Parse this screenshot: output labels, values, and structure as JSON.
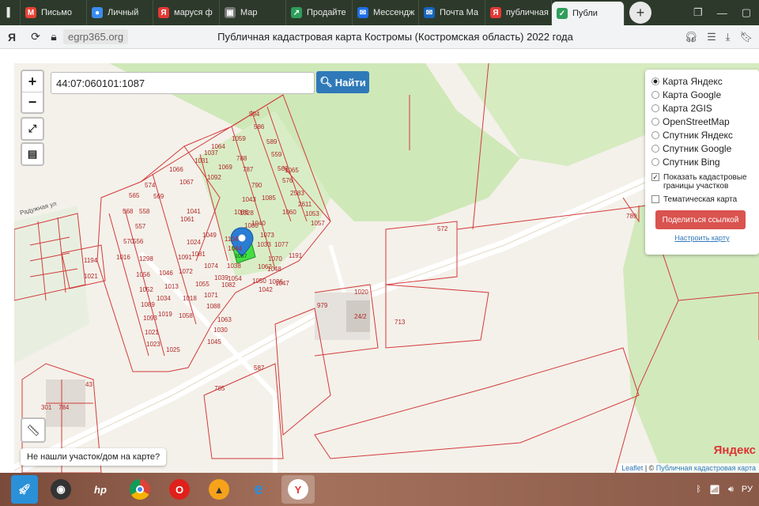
{
  "browser": {
    "tabs": [
      {
        "label": "Письмо",
        "icon": "mail-icon",
        "color": "#e94235",
        "glyph": "M"
      },
      {
        "label": "Личный",
        "icon": "dots-icon",
        "color": "#3b8cf0",
        "glyph": "●"
      },
      {
        "label": "маруся ф",
        "icon": "yandex-icon",
        "color": "#e53935",
        "glyph": "Я"
      },
      {
        "label": "Мар",
        "icon": "video-icon",
        "color": "#777777",
        "glyph": "▣"
      },
      {
        "label": "Продайте",
        "icon": "sell-icon",
        "color": "#2e9e5b",
        "glyph": "↗"
      },
      {
        "label": "Мессендж",
        "icon": "messenger-icon",
        "color": "#1e6fe8",
        "glyph": "✉"
      },
      {
        "label": "Почта Ма",
        "icon": "mail-ru-icon",
        "color": "#1565c0",
        "glyph": "✉"
      },
      {
        "label": "публичная",
        "icon": "yandex-icon",
        "color": "#e53935",
        "glyph": "Я"
      },
      {
        "label": "Публи",
        "icon": "check-icon",
        "color": "#2e9e5b",
        "glyph": "✓"
      }
    ],
    "new_tab": "+",
    "domain": "egrp365.org",
    "page_title": "Публичная кадастровая карта Костромы (Костромская область) 2022 года"
  },
  "map": {
    "zoom_in": "+",
    "zoom_out": "−",
    "search_value": "44:07:060101:1087",
    "find_label": "Найти",
    "layers": {
      "options": [
        "Карта Яндекс",
        "Карта Google",
        "Карта 2GIS",
        "OpenStreetMap",
        "Спутник Яндекс",
        "Спутник Google",
        "Спутник Bing"
      ],
      "selected": "Карта Яндекс",
      "show_cadastral": "Показать кадастровые границы участков",
      "show_cadastral_checked": true,
      "thematic": "Тематическая карта",
      "thematic_checked": false,
      "share_label": "Поделиться ссылкой",
      "setup_label": "Настроить карту"
    },
    "not_found": "Не нашли участок/дом на карте?",
    "attribution_leaflet": "Leaflet",
    "attribution_pkk": "Публичная кадастровая карта",
    "yandex_logo": "Яндекс",
    "street": "Радужная ул",
    "parcels": [
      "594",
      "586",
      "589",
      "559",
      "563",
      "576",
      "2583",
      "2611",
      "1053",
      "1057",
      "1059",
      "1064",
      "1037",
      "1031",
      "788",
      "1069",
      "1092",
      "787",
      "790",
      "1085",
      "1060",
      "1065",
      "1066",
      "1067",
      "574",
      "565",
      "569",
      "568",
      "558",
      "557",
      "570",
      "556",
      "1016",
      "1298",
      "1056",
      "1052",
      "1089",
      "1093",
      "1021",
      "1023",
      "1025",
      "1034",
      "1018",
      "1019",
      "1058",
      "1013",
      "1046",
      "1072",
      "1091",
      "1024",
      "1041",
      "1049",
      "1061",
      "1081",
      "1074",
      "1055",
      "1071",
      "1082",
      "1088",
      "1039",
      "1030",
      "1063",
      "1045",
      "1054",
      "1038",
      "1044",
      "1104",
      "1086",
      "1043",
      "1028",
      "1080",
      "1073",
      "1040",
      "1033",
      "1062",
      "1070",
      "1050",
      "1042",
      "1048",
      "1036",
      "1047",
      "1077",
      "1191",
      "1194",
      "1021",
      "572",
      "789",
      "979",
      "713",
      "24/2",
      "1020",
      "587",
      "785",
      "301",
      "784",
      "43"
    ],
    "selected_parcel": "1087"
  },
  "taskbar": {
    "apps": [
      "rocket",
      "webcam",
      "hp",
      "chrome",
      "opera",
      "avast",
      "ie",
      "yandex"
    ],
    "tray_lang": "РУ"
  }
}
